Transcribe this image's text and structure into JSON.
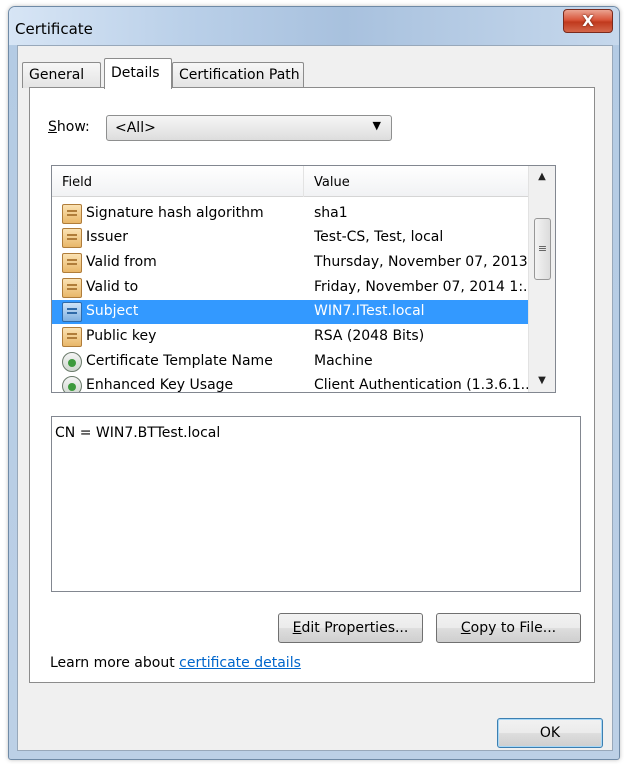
{
  "window": {
    "title": "Certificate",
    "close_glyph": "X"
  },
  "tabs": [
    {
      "label": "General",
      "active": false
    },
    {
      "label": "Details",
      "active": true
    },
    {
      "label": "Certification Path",
      "active": false
    }
  ],
  "show": {
    "label_accel": "S",
    "label_rest": "how:",
    "selected": "<All>"
  },
  "list": {
    "headers": {
      "field": "Field",
      "value": "Value"
    },
    "rows": [
      {
        "field": "Signature hash algorithm",
        "value": "sha1",
        "icon": "certificate-icon"
      },
      {
        "field": "Issuer",
        "value": "Test-CS, Test, local",
        "icon": "certificate-icon"
      },
      {
        "field": "Valid from",
        "value": "Thursday, November 07, 2013...",
        "icon": "certificate-icon"
      },
      {
        "field": "Valid to",
        "value": "Friday, November 07, 2014 1:...",
        "icon": "certificate-icon"
      },
      {
        "field": "Subject",
        "value": "WIN7.ITest.local",
        "icon": "certificate-icon",
        "selected": true
      },
      {
        "field": "Public key",
        "value": "RSA (2048 Bits)",
        "icon": "certificate-icon"
      },
      {
        "field": "Certificate Template Name",
        "value": "Machine",
        "icon": "extension-icon"
      },
      {
        "field": "Enhanced Key Usage",
        "value": "Client Authentication (1.3.6.1...",
        "icon": "extension-icon"
      }
    ]
  },
  "detail": {
    "text": "CN = WIN7.BTTest.local"
  },
  "buttons": {
    "edit_accel": "E",
    "edit_rest": "dit Properties...",
    "copy_accel": "C",
    "copy_rest": "opy to File...",
    "ok": "OK"
  },
  "learn_more": {
    "prefix": "Learn more about ",
    "link": "certificate details"
  }
}
